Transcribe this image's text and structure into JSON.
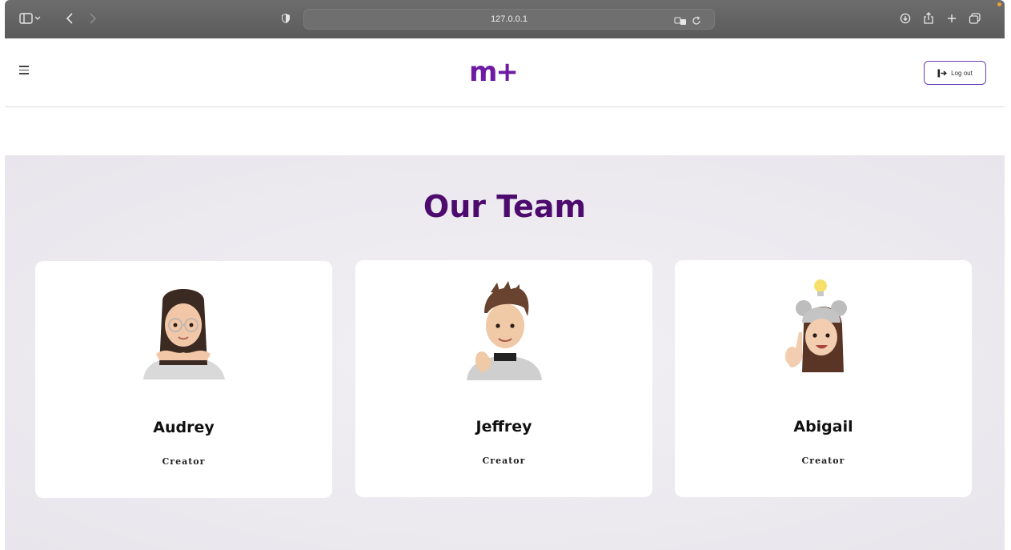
{
  "browser": {
    "url": "127.0.0.1"
  },
  "header": {
    "logo_text": "m+",
    "logout_label": "Log out"
  },
  "team": {
    "title": "Our Team",
    "members": [
      {
        "name": "Audrey",
        "role": "Creator"
      },
      {
        "name": "Jeffrey",
        "role": "Creator"
      },
      {
        "name": "Abigail",
        "role": "Creator"
      }
    ]
  },
  "colors": {
    "brand": "#6e1aa3",
    "title": "#4e0b6e",
    "button_border": "#6b3fb8"
  }
}
